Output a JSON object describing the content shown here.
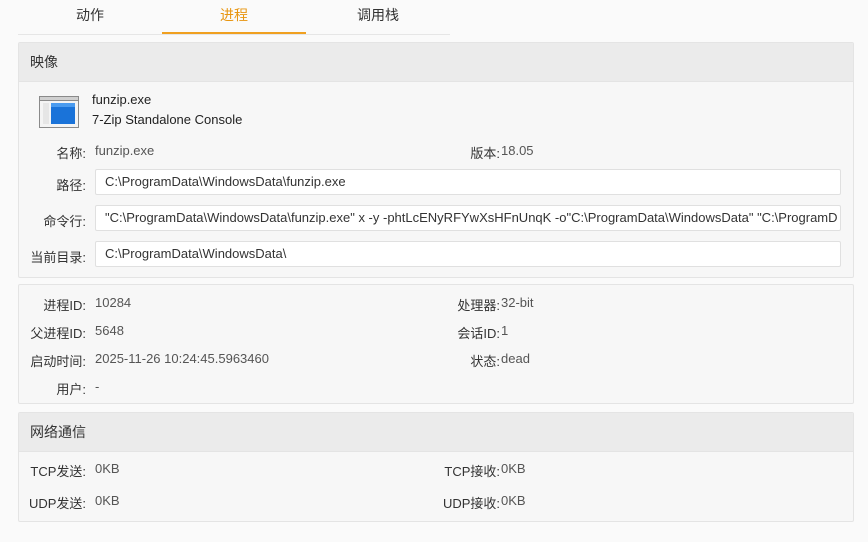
{
  "tabs": [
    {
      "label": "动作"
    },
    {
      "label": "进程"
    },
    {
      "label": "调用栈"
    }
  ],
  "image_panel": {
    "title": "映像",
    "icon": "window-app-icon",
    "app_name": "funzip.exe",
    "app_description": "7-Zip Standalone Console",
    "name_label": "名称:",
    "name_value": "funzip.exe",
    "version_label": "版本:",
    "version_value": "18.05",
    "path_label": "路径:",
    "path_value": "C:\\ProgramData\\WindowsData\\funzip.exe",
    "cmdline_label": "命令行:",
    "cmdline_value": "\"C:\\ProgramData\\WindowsData\\funzip.exe\" x -y -phtLcENyRFYwXsHFnUnqK -o\"C:\\ProgramData\\WindowsData\" \"C:\\ProgramD",
    "cwd_label": "当前目录:",
    "cwd_value": "C:\\ProgramData\\WindowsData\\"
  },
  "process_panel": {
    "pid_label": "进程ID:",
    "pid_value": "10284",
    "arch_label": "处理器:",
    "arch_value": "32-bit",
    "ppid_label": "父进程ID:",
    "ppid_value": "5648",
    "session_label": "会话ID:",
    "session_value": "1",
    "start_label": "启动时间:",
    "start_value": "2025-11-26 10:24:45.5963460",
    "state_label": "状态:",
    "state_value": "dead",
    "user_label": "用户:",
    "user_value": "-"
  },
  "network_panel": {
    "title": "网络通信",
    "tcp_send_label": "TCP发送:",
    "tcp_send_value": "0KB",
    "tcp_recv_label": "TCP接收:",
    "tcp_recv_value": "0KB",
    "udp_send_label": "UDP发送:",
    "udp_send_value": "0KB",
    "udp_recv_label": "UDP接收:",
    "udp_recv_value": "0KB"
  },
  "colors": {
    "accent": "#f0a020",
    "active_tab_text": "#e8950f",
    "icon_blue": "#1a73d9"
  }
}
